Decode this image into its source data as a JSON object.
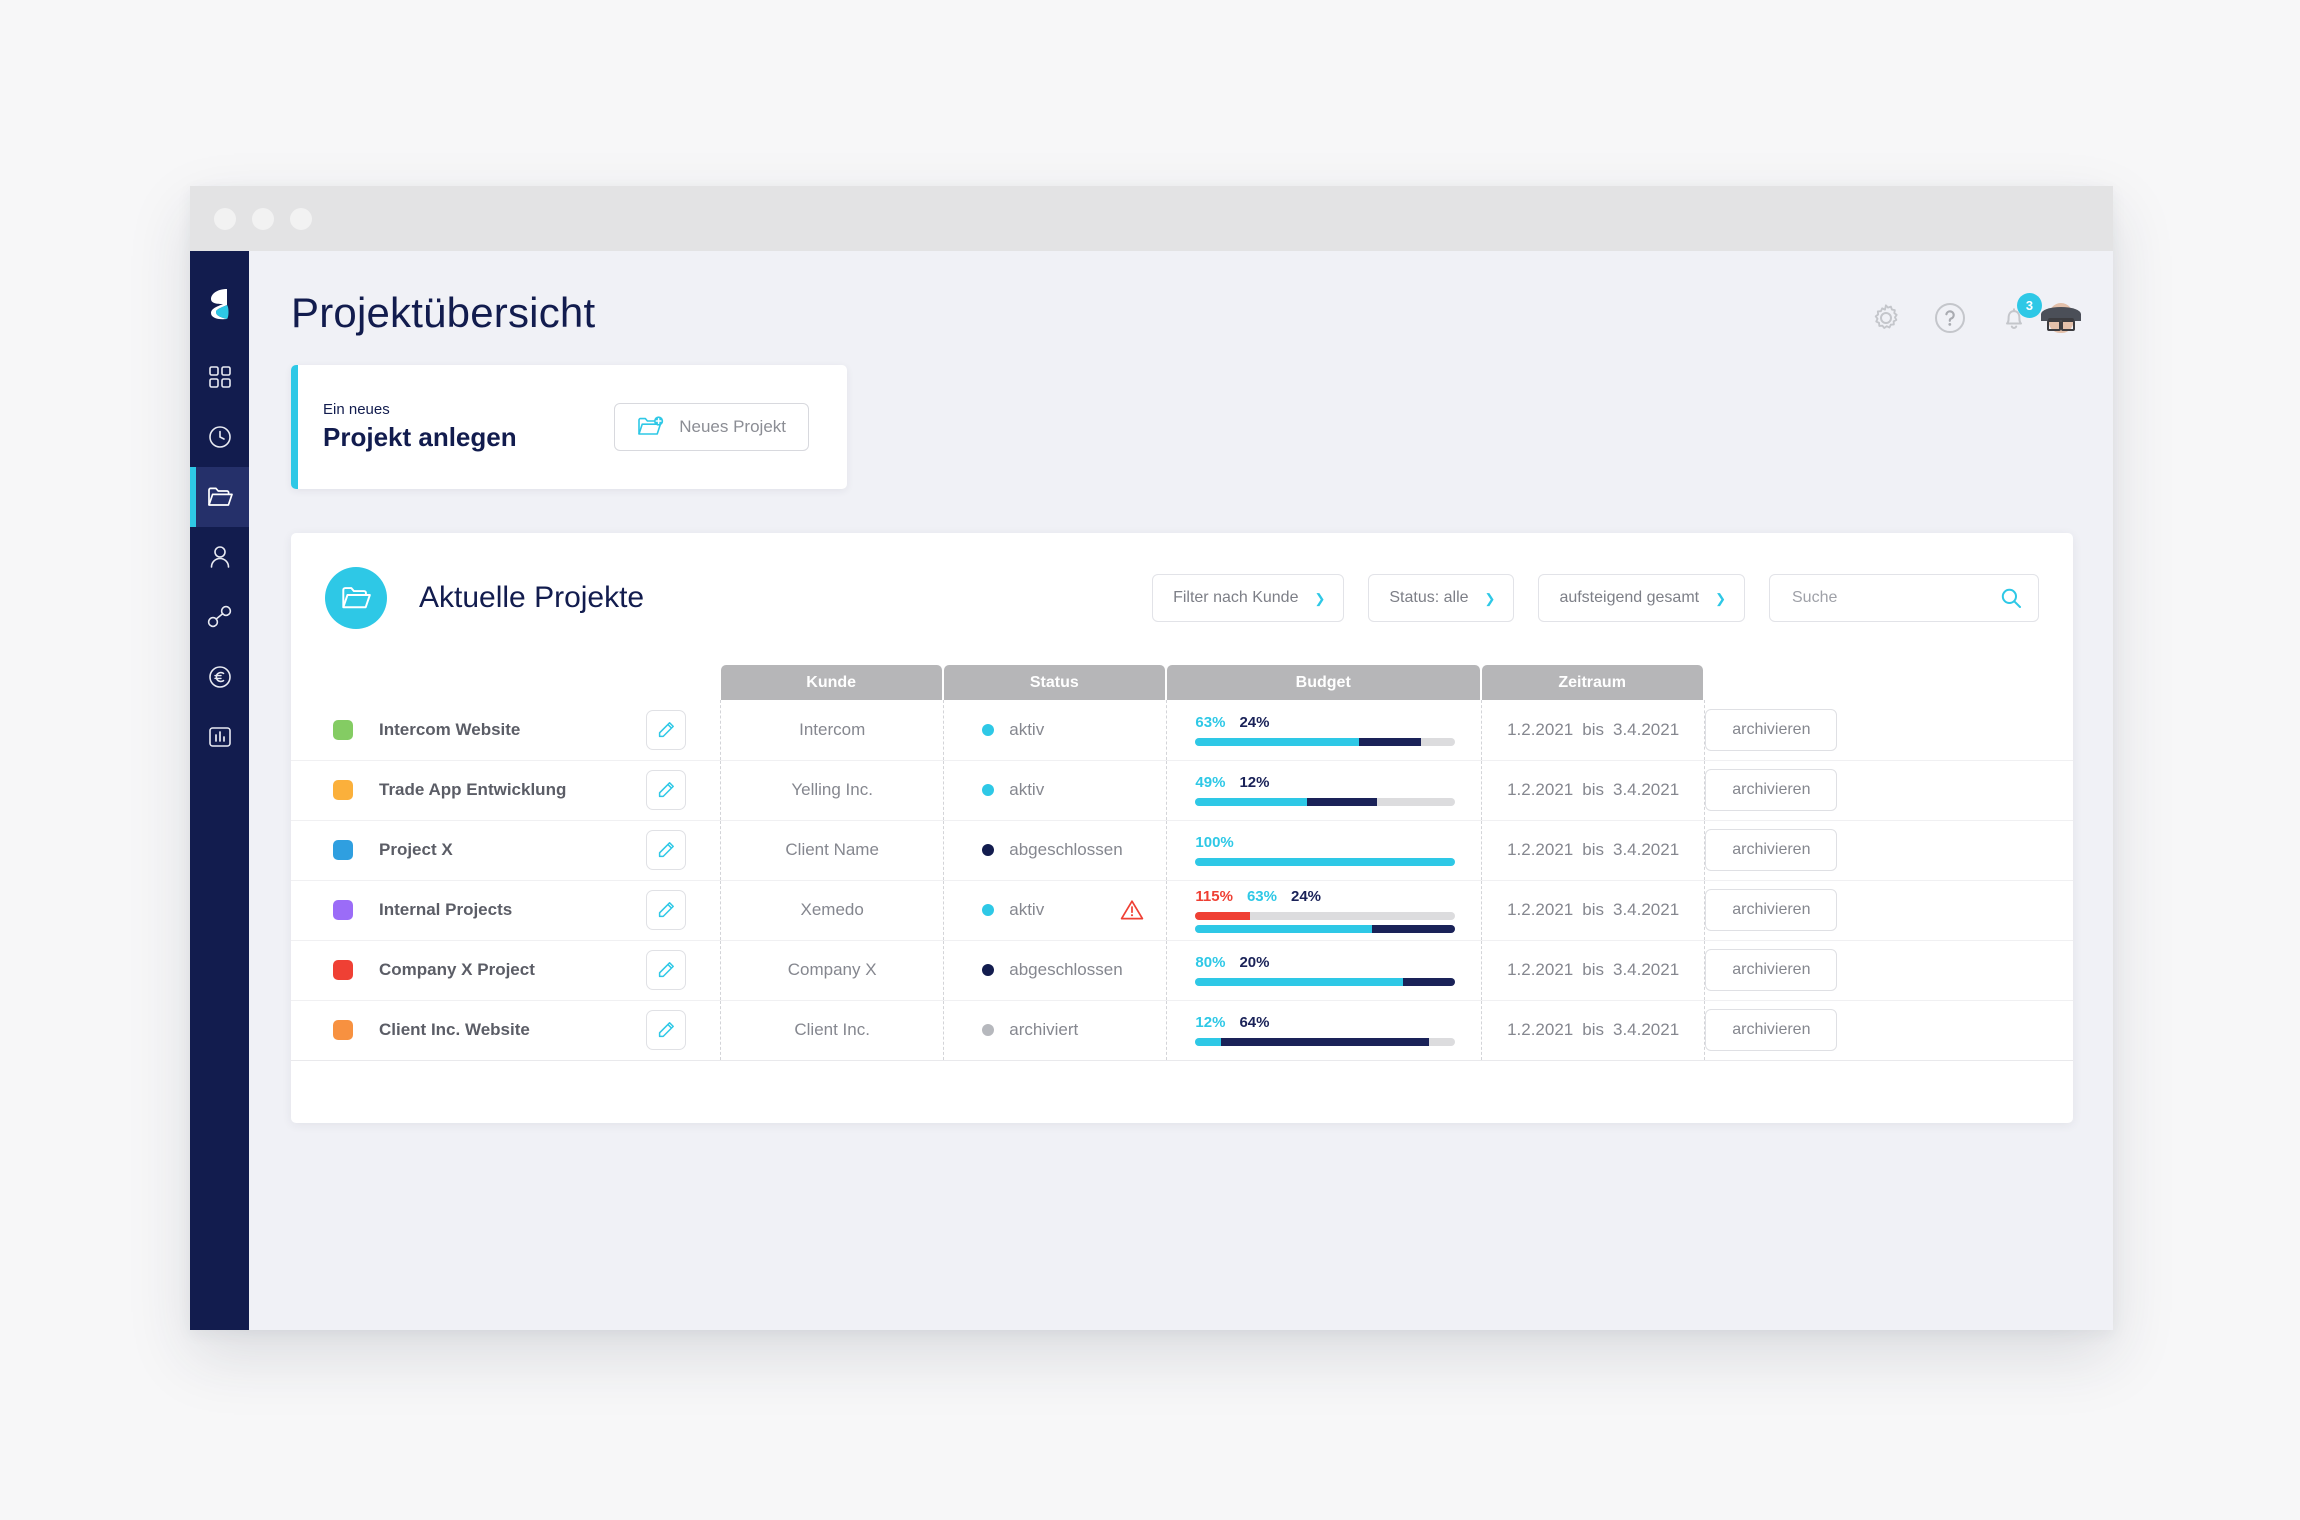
{
  "window": {
    "dots": [
      "red-dot",
      "yellow-dot",
      "green-dot"
    ]
  },
  "brand": {
    "logo": "stack-logo"
  },
  "sidebar": {
    "items": [
      {
        "icon": "grid-icon",
        "name": "dashboard",
        "active": false
      },
      {
        "icon": "clock-icon",
        "name": "time",
        "active": false
      },
      {
        "icon": "folder-icon",
        "name": "projects",
        "active": true
      },
      {
        "icon": "user-icon",
        "name": "contacts",
        "active": false
      },
      {
        "icon": "nodes-icon",
        "name": "network",
        "active": false
      },
      {
        "icon": "euro-icon",
        "name": "finance",
        "active": false
      },
      {
        "icon": "bar-chart-icon",
        "name": "reports",
        "active": false
      }
    ]
  },
  "header": {
    "title": "Projektübersicht",
    "icons": [
      {
        "name": "gear-icon"
      },
      {
        "name": "help-icon"
      },
      {
        "name": "bell-icon",
        "badge": "3"
      },
      {
        "name": "avatar"
      }
    ],
    "notification_count": "3"
  },
  "create_card": {
    "eyebrow": "Ein neues",
    "headline": "Projekt anlegen",
    "button_label": "Neues Projekt",
    "button_icon": "folder-plus-icon",
    "accent_color": "#2ec8e6"
  },
  "panel": {
    "icon": "folder-icon",
    "title": "Aktuelle Projekte",
    "filters": [
      {
        "name": "customer-filter",
        "label": "Filter nach Kunde"
      },
      {
        "name": "status-filter",
        "label": "Status: alle"
      },
      {
        "name": "sort-filter",
        "label": "aufsteigend gesamt"
      }
    ],
    "search": {
      "placeholder": "Suche",
      "value": "",
      "icon": "search-icon"
    },
    "columns": [
      "Kunde",
      "Status",
      "Budget",
      "Zeitraum"
    ],
    "action_label": "archivieren",
    "date_separator": "bis",
    "rows": [
      {
        "color": "#84cc63",
        "project": "Intercom Website",
        "customer": "Intercom",
        "status": "aktiv",
        "status_color": "#2ec8e6",
        "warning": false,
        "budget": [
          {
            "label": "63%",
            "value": 63,
            "type": "cyan"
          },
          {
            "label": "24%",
            "value": 24,
            "type": "navy"
          }
        ],
        "budget_over": null,
        "start": "1.2.2021",
        "end": "3.4.2021",
        "action": "archivieren"
      },
      {
        "color": "#fbb03b",
        "project": "Trade App Entwicklung",
        "customer": "Yelling Inc.",
        "status": "aktiv",
        "status_color": "#2ec8e6",
        "warning": false,
        "budget": [
          {
            "label": "49%",
            "value": 43,
            "type": "cyan"
          },
          {
            "label": "12%",
            "value": 27,
            "type": "navy"
          }
        ],
        "budget_over": null,
        "start": "1.2.2021",
        "end": "3.4.2021",
        "action": "archivieren"
      },
      {
        "color": "#2f9fe0",
        "project": "Project X",
        "customer": "Client Name",
        "status": "abgeschlossen",
        "status_color": "#121c4e",
        "warning": false,
        "budget": [
          {
            "label": "100%",
            "value": 100,
            "type": "cyan"
          }
        ],
        "budget_over": null,
        "start": "1.2.2021",
        "end": "3.4.2021",
        "action": "archivieren"
      },
      {
        "color": "#9b6cf7",
        "project": "Internal Projects",
        "customer": "Xemedo",
        "status": "aktiv",
        "status_color": "#2ec8e6",
        "warning": true,
        "budget": [
          {
            "label": "63%",
            "value": 68,
            "type": "cyan"
          },
          {
            "label": "24%",
            "value": 32,
            "type": "navy"
          }
        ],
        "budget_over": {
          "label": "115%",
          "value": 21,
          "type": "red"
        },
        "start": "1.2.2021",
        "end": "3.4.2021",
        "action": "archivieren"
      },
      {
        "color": "#ef4034",
        "project": "Company X Project",
        "customer": "Company X",
        "status": "abgeschlossen",
        "status_color": "#121c4e",
        "warning": false,
        "budget": [
          {
            "label": "80%",
            "value": 80,
            "type": "cyan"
          },
          {
            "label": "20%",
            "value": 20,
            "type": "navy"
          }
        ],
        "budget_over": null,
        "start": "1.2.2021",
        "end": "3.4.2021",
        "action": "archivieren"
      },
      {
        "color": "#f79140",
        "project": "Client Inc. Website",
        "customer": "Client Inc.",
        "status": "archiviert",
        "status_color": "#b6b8bd",
        "warning": false,
        "budget": [
          {
            "label": "12%",
            "value": 10,
            "type": "cyan"
          },
          {
            "label": "64%",
            "value": 80,
            "type": "navy"
          }
        ],
        "budget_over": null,
        "start": "1.2.2021",
        "end": "3.4.2021",
        "action": "archivieren"
      }
    ]
  },
  "colors": {
    "navy": "#121c4e",
    "cyan": "#2ec8e6",
    "red": "#ef4034",
    "page_bg": "#f0f1f6",
    "header_gray": "#b6b6b8"
  }
}
